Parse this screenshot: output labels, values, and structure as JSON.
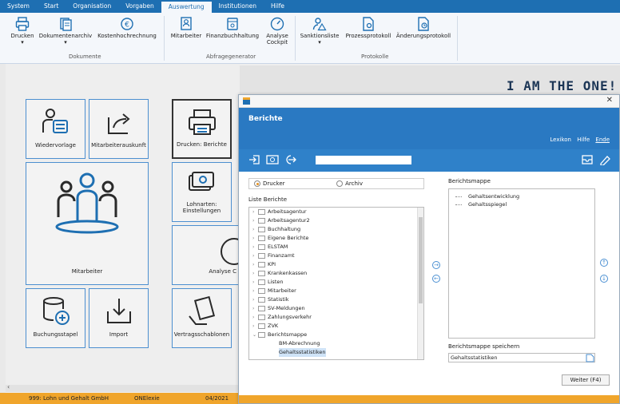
{
  "menu": [
    "System",
    "Start",
    "Organisation",
    "Vorgaben",
    "Auswertung",
    "Institutionen",
    "Hilfe"
  ],
  "menu_active_index": 4,
  "ribbon": {
    "buttons": [
      {
        "label": "Drucken",
        "sub": "▾",
        "icon": "printer-icon"
      },
      {
        "label": "Dokumentenarchiv",
        "sub": "▾",
        "icon": "archive-icon"
      },
      {
        "label": "Kostenhochrechnung",
        "sub": "",
        "icon": "euro-icon"
      },
      {
        "label": "Mitarbeiter",
        "sub": "",
        "icon": "user-card-icon"
      },
      {
        "label": "Finanzbuchhaltung",
        "sub": "",
        "icon": "ledger-icon"
      },
      {
        "label": "Analyse",
        "sub": "Cockpit",
        "icon": "gauge-icon"
      },
      {
        "label": "Sanktionsliste",
        "sub": "▾",
        "icon": "person-warning-icon"
      },
      {
        "label": "Prozessprotokoll",
        "sub": "",
        "icon": "doc-gear-icon"
      },
      {
        "label": "Änderungsprotokoll",
        "sub": "",
        "icon": "doc-clock-icon"
      }
    ],
    "groups": [
      "Dokumente",
      "Abfragegenerator",
      "Protokolle"
    ]
  },
  "banner_text": "I AM THE ONE!",
  "tiles": {
    "wiedervorlage": "Wiedervorlage",
    "mitarbeiterauskunft": "Mitarbeiterauskunft",
    "drucken_berichte": "Drucken: Berichte",
    "mitarbeiter": "Mitarbeiter",
    "lohnarten": "Lohnarten:\nEinstellungen",
    "analyse": "Analyse C",
    "buchungsstapel": "Buchungsstapel",
    "import": "Import",
    "vertragsschablonen": "Vertragsschablonen"
  },
  "status": {
    "company": "999: Lohn und Gehalt GmbH",
    "mode": "ONElexie",
    "period": "04/2021"
  },
  "dialog": {
    "title": "Berichte",
    "links": [
      "Lexikon",
      "Hilfe",
      "Ende"
    ],
    "search_value": "",
    "radio_drucker": "Drucker",
    "radio_archiv": "Archiv",
    "list_label": "Liste Berichte",
    "tree": [
      "Arbeitsagentur",
      "Arbeitsagentur2",
      "Buchhaltung",
      "Eigene Berichte",
      "ELSTAM",
      "Finanzamt",
      "KPI",
      "Krankenkassen",
      "Listen",
      "Mitarbeiter",
      "Statistik",
      "SV-Meldungen",
      "Zahlungsverkehr",
      "ZVK",
      "Berichtsmappe"
    ],
    "tree_children": [
      "BM-Abrechnung",
      "Gehaltsstatistiken"
    ],
    "mappe_label": "Berichtsmappe",
    "mappe_items": [
      "Gehaltsentwicklung",
      "Gehaltsspiegel"
    ],
    "save_label": "Berichtsmappe speichern",
    "save_value": "Gehaltsstatistiken",
    "weiter": "Weiter (F4)"
  }
}
